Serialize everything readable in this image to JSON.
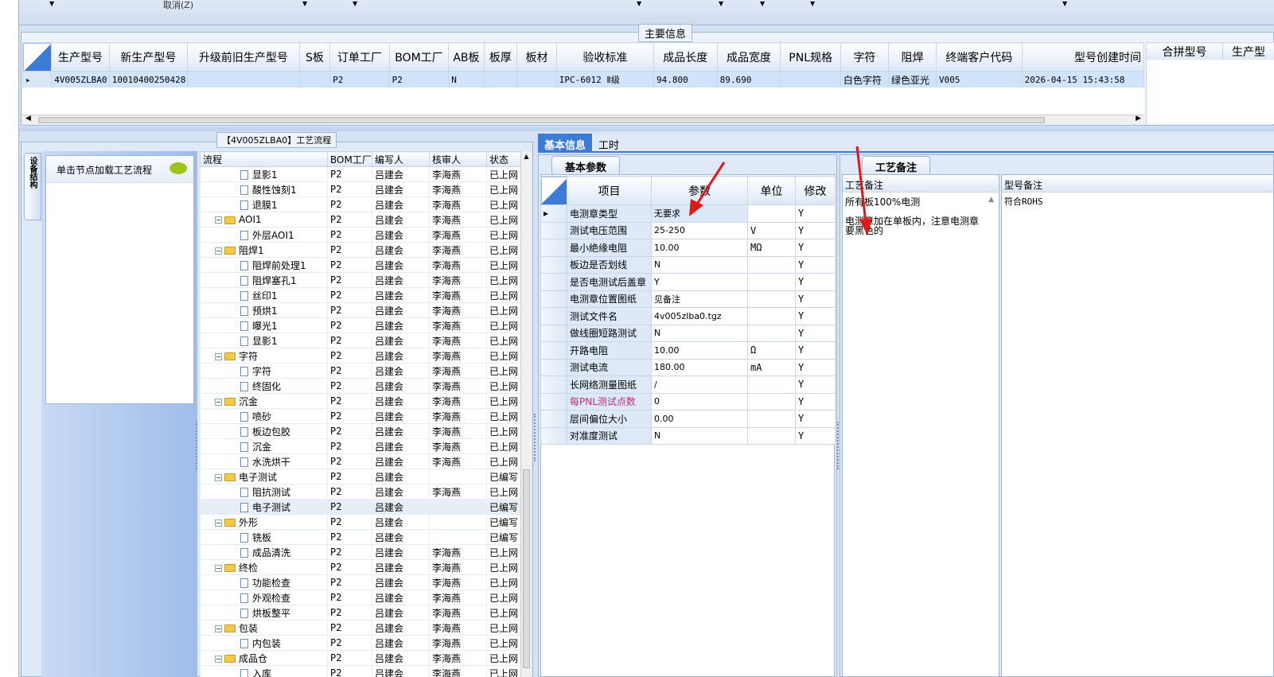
{
  "toolbar": {
    "cancel_label": "取消(Z)"
  },
  "main_info": {
    "group_title": "主要信息",
    "columns": [
      "生产型号",
      "新生产型号",
      "升级前旧生产型号",
      "S板",
      "订单工厂",
      "BOM工厂",
      "AB板",
      "板厚",
      "板材",
      "验收标准",
      "成品长度",
      "成品宽度",
      "PNL规格",
      "字符",
      "阻焊",
      "终端客户代码",
      "型号创建时间"
    ],
    "row": [
      "4V005ZLBA0",
      "10010400250428",
      "",
      "",
      "P2",
      "P2",
      "N",
      "",
      "",
      "IPC-6012 Ⅱ级",
      "94.800",
      "89.690",
      "",
      "白色字符",
      "绿色亚光",
      "V005",
      "2026-04-15 15:43:58"
    ],
    "merge_columns": [
      "合拼型号",
      "生产型"
    ]
  },
  "process_panel": {
    "title": "【4V005ZLBA0】工艺流程",
    "side_tab": "设备结构",
    "load_hint": "单击节点加载工艺流程",
    "columns": [
      "流程",
      "BOM工厂",
      "编写人",
      "核审人",
      "状态"
    ],
    "rows": [
      {
        "level": 2,
        "type": "doc",
        "name": "显影1",
        "bom": "P2",
        "writer": "吕建会",
        "reviewer": "李海燕",
        "status": "已上网"
      },
      {
        "level": 2,
        "type": "doc",
        "name": "酸性蚀刻1",
        "bom": "P2",
        "writer": "吕建会",
        "reviewer": "李海燕",
        "status": "已上网"
      },
      {
        "level": 2,
        "type": "doc",
        "name": "退膜1",
        "bom": "P2",
        "writer": "吕建会",
        "reviewer": "李海燕",
        "status": "已上网"
      },
      {
        "level": 1,
        "type": "folder",
        "name": "AOI1",
        "bom": "P2",
        "writer": "吕建会",
        "reviewer": "李海燕",
        "status": "已上网"
      },
      {
        "level": 2,
        "type": "doc",
        "name": "外层AOI1",
        "bom": "P2",
        "writer": "吕建会",
        "reviewer": "李海燕",
        "status": "已上网"
      },
      {
        "level": 1,
        "type": "folder",
        "name": "阻焊1",
        "bom": "P2",
        "writer": "吕建会",
        "reviewer": "李海燕",
        "status": "已上网"
      },
      {
        "level": 2,
        "type": "doc",
        "name": "阻焊前处理1",
        "bom": "P2",
        "writer": "吕建会",
        "reviewer": "李海燕",
        "status": "已上网"
      },
      {
        "level": 2,
        "type": "doc",
        "name": "阻焊塞孔1",
        "bom": "P2",
        "writer": "吕建会",
        "reviewer": "李海燕",
        "status": "已上网"
      },
      {
        "level": 2,
        "type": "doc",
        "name": "丝印1",
        "bom": "P2",
        "writer": "吕建会",
        "reviewer": "李海燕",
        "status": "已上网"
      },
      {
        "level": 2,
        "type": "doc",
        "name": "预烘1",
        "bom": "P2",
        "writer": "吕建会",
        "reviewer": "李海燕",
        "status": "已上网"
      },
      {
        "level": 2,
        "type": "doc",
        "name": "曝光1",
        "bom": "P2",
        "writer": "吕建会",
        "reviewer": "李海燕",
        "status": "已上网"
      },
      {
        "level": 2,
        "type": "doc",
        "name": "显影1",
        "bom": "P2",
        "writer": "吕建会",
        "reviewer": "李海燕",
        "status": "已上网"
      },
      {
        "level": 1,
        "type": "folder",
        "name": "字符",
        "bom": "P2",
        "writer": "吕建会",
        "reviewer": "李海燕",
        "status": "已上网"
      },
      {
        "level": 2,
        "type": "doc",
        "name": "字符",
        "bom": "P2",
        "writer": "吕建会",
        "reviewer": "李海燕",
        "status": "已上网"
      },
      {
        "level": 2,
        "type": "doc",
        "name": "终固化",
        "bom": "P2",
        "writer": "吕建会",
        "reviewer": "李海燕",
        "status": "已上网"
      },
      {
        "level": 1,
        "type": "folder",
        "name": "沉金",
        "bom": "P2",
        "writer": "吕建会",
        "reviewer": "李海燕",
        "status": "已上网"
      },
      {
        "level": 2,
        "type": "doc",
        "name": "喷砂",
        "bom": "P2",
        "writer": "吕建会",
        "reviewer": "李海燕",
        "status": "已上网"
      },
      {
        "level": 2,
        "type": "doc",
        "name": "板边包胶",
        "bom": "P2",
        "writer": "吕建会",
        "reviewer": "李海燕",
        "status": "已上网"
      },
      {
        "level": 2,
        "type": "doc",
        "name": "沉金",
        "bom": "P2",
        "writer": "吕建会",
        "reviewer": "李海燕",
        "status": "已上网"
      },
      {
        "level": 2,
        "type": "doc",
        "name": "水洗烘干",
        "bom": "P2",
        "writer": "吕建会",
        "reviewer": "李海燕",
        "status": "已上网"
      },
      {
        "level": 1,
        "type": "folder",
        "name": "电子测试",
        "bom": "P2",
        "writer": "吕建会",
        "reviewer": "",
        "status": "已编写"
      },
      {
        "level": 2,
        "type": "doc",
        "name": "阻抗测试",
        "bom": "P2",
        "writer": "吕建会",
        "reviewer": "李海燕",
        "status": "已上网"
      },
      {
        "level": 2,
        "type": "doc",
        "name": "电子测试",
        "bom": "P2",
        "writer": "吕建会",
        "reviewer": "",
        "status": "已编写",
        "selected": true
      },
      {
        "level": 1,
        "type": "folder",
        "name": "外形",
        "bom": "P2",
        "writer": "吕建会",
        "reviewer": "",
        "status": "已编写"
      },
      {
        "level": 2,
        "type": "doc",
        "name": "铣板",
        "bom": "P2",
        "writer": "吕建会",
        "reviewer": "",
        "status": "已编写"
      },
      {
        "level": 2,
        "type": "doc",
        "name": "成品清洗",
        "bom": "P2",
        "writer": "吕建会",
        "reviewer": "李海燕",
        "status": "已上网"
      },
      {
        "level": 1,
        "type": "folder",
        "name": "终检",
        "bom": "P2",
        "writer": "吕建会",
        "reviewer": "李海燕",
        "status": "已上网"
      },
      {
        "level": 2,
        "type": "doc",
        "name": "功能检查",
        "bom": "P2",
        "writer": "吕建会",
        "reviewer": "李海燕",
        "status": "已上网"
      },
      {
        "level": 2,
        "type": "doc",
        "name": "外观检查",
        "bom": "P2",
        "writer": "吕建会",
        "reviewer": "李海燕",
        "status": "已上网"
      },
      {
        "level": 2,
        "type": "doc",
        "name": "烘板整平",
        "bom": "P2",
        "writer": "吕建会",
        "reviewer": "李海燕",
        "status": "已上网"
      },
      {
        "level": 1,
        "type": "folder",
        "name": "包装",
        "bom": "P2",
        "writer": "吕建会",
        "reviewer": "李海燕",
        "status": "已上网"
      },
      {
        "level": 2,
        "type": "doc",
        "name": "内包装",
        "bom": "P2",
        "writer": "吕建会",
        "reviewer": "李海燕",
        "status": "已上网"
      },
      {
        "level": 1,
        "type": "folder",
        "name": "成品仓",
        "bom": "P2",
        "writer": "吕建会",
        "reviewer": "李海燕",
        "status": "已上网"
      },
      {
        "level": 2,
        "type": "doc",
        "name": "入库",
        "bom": "P2",
        "writer": "吕建会",
        "reviewer": "李海燕",
        "status": "已上网"
      }
    ]
  },
  "detail_tabs": [
    "基本信息",
    "工时"
  ],
  "basic_params": {
    "subtab": "基本参数",
    "columns": [
      "项目",
      "参数",
      "单位",
      "修改"
    ],
    "rows": [
      {
        "item": "电测章类型",
        "param": "无要求",
        "unit": "",
        "mod": "Y",
        "current": true
      },
      {
        "item": "测试电压范围",
        "param": "25-250",
        "unit": "V",
        "mod": "Y"
      },
      {
        "item": "最小绝缘电阻",
        "param": "10.00",
        "unit": "MΩ",
        "mod": "Y"
      },
      {
        "item": "板边是否划线",
        "param": "N",
        "unit": "",
        "mod": "Y"
      },
      {
        "item": "是否电测试后盖章",
        "param": "Y",
        "unit": "",
        "mod": "Y"
      },
      {
        "item": "电测章位置图纸",
        "param": "见备注",
        "unit": "",
        "mod": "Y"
      },
      {
        "item": "测试文件名",
        "param": "4v005zlba0.tgz",
        "unit": "",
        "mod": "Y"
      },
      {
        "item": "做线圈短路测试",
        "param": "N",
        "unit": "",
        "mod": "Y"
      },
      {
        "item": "开路电阻",
        "param": "10.00",
        "unit": "Ω",
        "mod": "Y"
      },
      {
        "item": "测试电流",
        "param": "180.00",
        "unit": "mA",
        "mod": "Y"
      },
      {
        "item": "长网络测量图纸",
        "param": "/",
        "unit": "",
        "mod": "Y"
      },
      {
        "item": "每PNL测试点数",
        "param": "0",
        "unit": "",
        "mod": "Y",
        "pink": true
      },
      {
        "item": "层间偏位大小",
        "param": "0.00",
        "unit": "",
        "mod": "Y"
      },
      {
        "item": "对准度测试",
        "param": "N",
        "unit": "",
        "mod": "Y"
      }
    ]
  },
  "remarks": {
    "subtab": "工艺备注",
    "col_process": "工艺备注",
    "col_model": "型号备注",
    "process_text_1": "所有板100%电测",
    "process_text_2": "电测章加在单板内，注意电测章要黑色的",
    "model_text": "符合ROHS"
  },
  "colors": {
    "accent": "#3d7cd6",
    "arrow": "#e01818",
    "pink": "#c0307a",
    "selection": "#cfe3fb"
  }
}
